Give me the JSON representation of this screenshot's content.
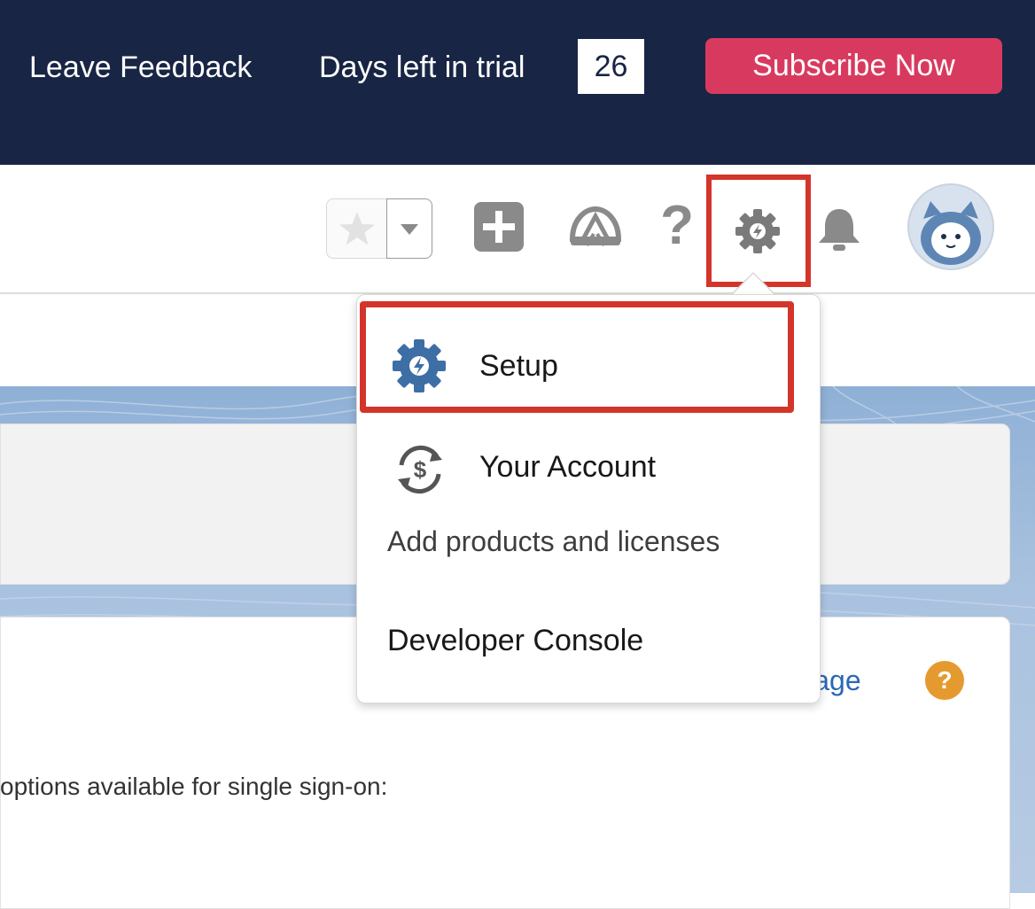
{
  "trial_bar": {
    "leave_feedback": "Leave Feedback",
    "days_left_label": "Days left in trial",
    "days_left_value": "26",
    "subscribe_label": "Subscribe Now"
  },
  "header": {
    "icons": [
      "star-icon",
      "chevron-down-icon",
      "add-icon",
      "trailhead-icon",
      "help-icon",
      "gear-icon",
      "bell-icon",
      "avatar"
    ],
    "help_glyph": "?"
  },
  "dropdown": {
    "setup_label": "Setup",
    "your_account_label": "Your Account",
    "your_account_note": "Add products and licenses",
    "developer_console_label": "Developer Console"
  },
  "page": {
    "help_link": "s Page",
    "help_badge": "?",
    "sso_text": "options available for single sign-on:"
  },
  "colors": {
    "trial_bar_bg": "#182544",
    "subscribe_bg": "#d83a5f",
    "highlight": "#d4352b",
    "setup_icon": "#3d6ea5",
    "link": "#2d67b6",
    "help_badge": "#e59a2f"
  }
}
